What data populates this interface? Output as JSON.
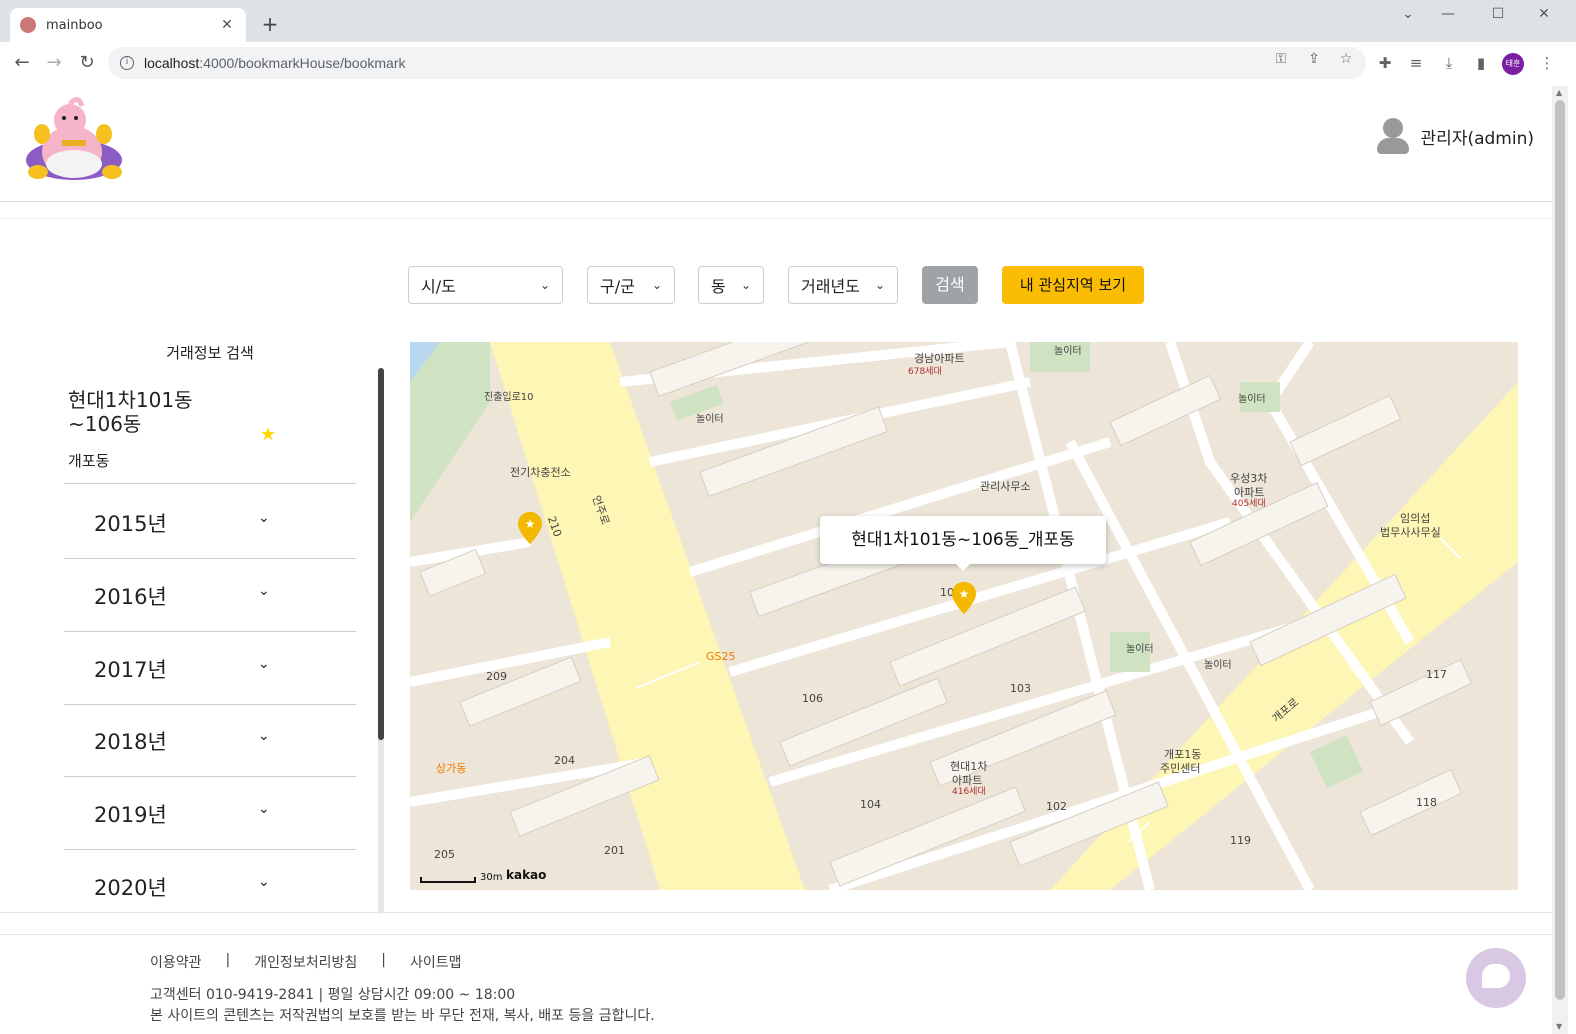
{
  "browser": {
    "tab_title": "mainboo",
    "url_host": "localhost",
    "url_rest": ":4000/bookmarkHouse/bookmark",
    "profile_initials": "태훈"
  },
  "header": {
    "user_name": "관리자(admin)"
  },
  "filters": {
    "sido": "시/도",
    "gugun": "구/군",
    "dong": "동",
    "year": "거래년도",
    "search_label": "검색",
    "my_area_label": "내 관심지역 보기"
  },
  "sidebar": {
    "title": "거래정보 검색",
    "apartment_name": "현대1차101동~106동",
    "apartment_dong": "개포동",
    "years": [
      "2015년",
      "2016년",
      "2017년",
      "2018년",
      "2019년",
      "2020년"
    ]
  },
  "map": {
    "tooltip": "현대1차101동~106동_개포동",
    "scale": "30m",
    "provider": "kakao",
    "labels": {
      "gyeongnam": "경남아파트",
      "gyeongnam_units": "678세대",
      "playground1": "놀이터",
      "playground2": "놀이터",
      "playground3": "놀이터",
      "playground4": "놀이터",
      "playground5": "놀이터",
      "jinchul": "진출입로10",
      "ev_charge": "전기차충전소",
      "mgmt": "관리사무소",
      "woosung": "우성3차",
      "woosung2": "아파트",
      "woosung_units": "405세대",
      "law": "임의섭",
      "law2": "법무사사무실",
      "gs25": "GS25",
      "shop": "상가동",
      "hyundai": "현대1차",
      "hyundai2": "아파트",
      "hyundai_units": "416세대",
      "center": "개포1동",
      "center2": "주민센터",
      "gaepo_ro": "개포로",
      "eonju_ro": "언주로",
      "b101": "101",
      "b103": "103",
      "b104": "104",
      "b106": "106",
      "b102": "102",
      "b117": "117",
      "b118": "118",
      "b119": "119",
      "b201": "201",
      "b204": "204",
      "b205": "205",
      "b209": "209",
      "b210": "210"
    }
  },
  "footer": {
    "links": [
      "이용약관",
      "|",
      "개인정보처리방침",
      "|",
      "사이트맵"
    ],
    "contact": "고객센터 010-9419-2841 | 평일 상담시간 09:00 ~ 18:00",
    "copyright": "본 사이트의 콘텐츠는 저작권법의 보호를 받는 바 무단 전재, 복사, 배포 등을 금합니다."
  }
}
